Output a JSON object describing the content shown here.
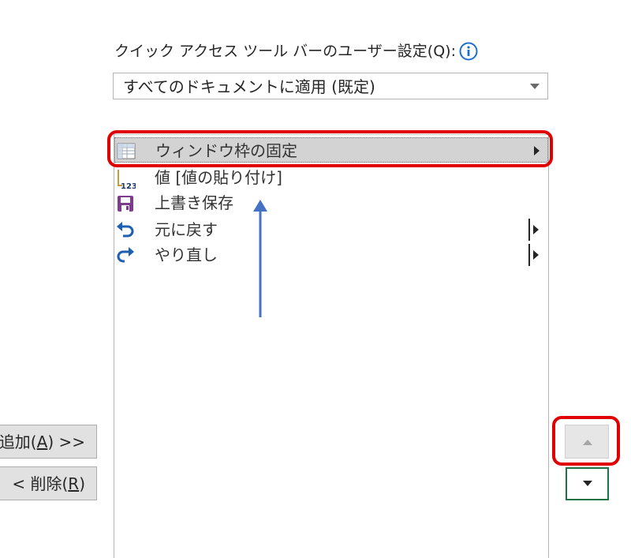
{
  "customize_qat": {
    "label": "クイック アクセス ツール バーのユーザー設定(Q):",
    "info_icon": "info-circle-icon",
    "scope_selected": "すべてのドキュメントに適用 (既定)"
  },
  "qat_items": [
    {
      "label": "ウィンドウ枠の固定",
      "icon": "freeze-panes-icon",
      "selected": true,
      "has_submenu": true
    },
    {
      "label": "値 [値の貼り付け]",
      "icon": "paste-values-icon",
      "selected": false
    },
    {
      "label": "上書き保存",
      "icon": "save-icon",
      "selected": false
    },
    {
      "label": "元に戻す",
      "icon": "undo-icon",
      "selected": false,
      "has_split": true
    },
    {
      "label": "やり直し",
      "icon": "redo-icon",
      "selected": false,
      "has_split": true
    }
  ],
  "buttons": {
    "add_prefix": "追加(",
    "add_key": "A",
    "add_suffix": ") >>",
    "remove_prefix": "< 削除(",
    "remove_key": "R",
    "remove_suffix": ")",
    "move_up_icon": "triangle-up-icon",
    "move_down_icon": "triangle-down-icon"
  },
  "colors": {
    "annotation_red": "#e00000",
    "annotation_blue": "#4472c4",
    "focus_green": "#217346",
    "selection_gray": "#d3d3d3",
    "info_blue": "#1e6fd0"
  }
}
